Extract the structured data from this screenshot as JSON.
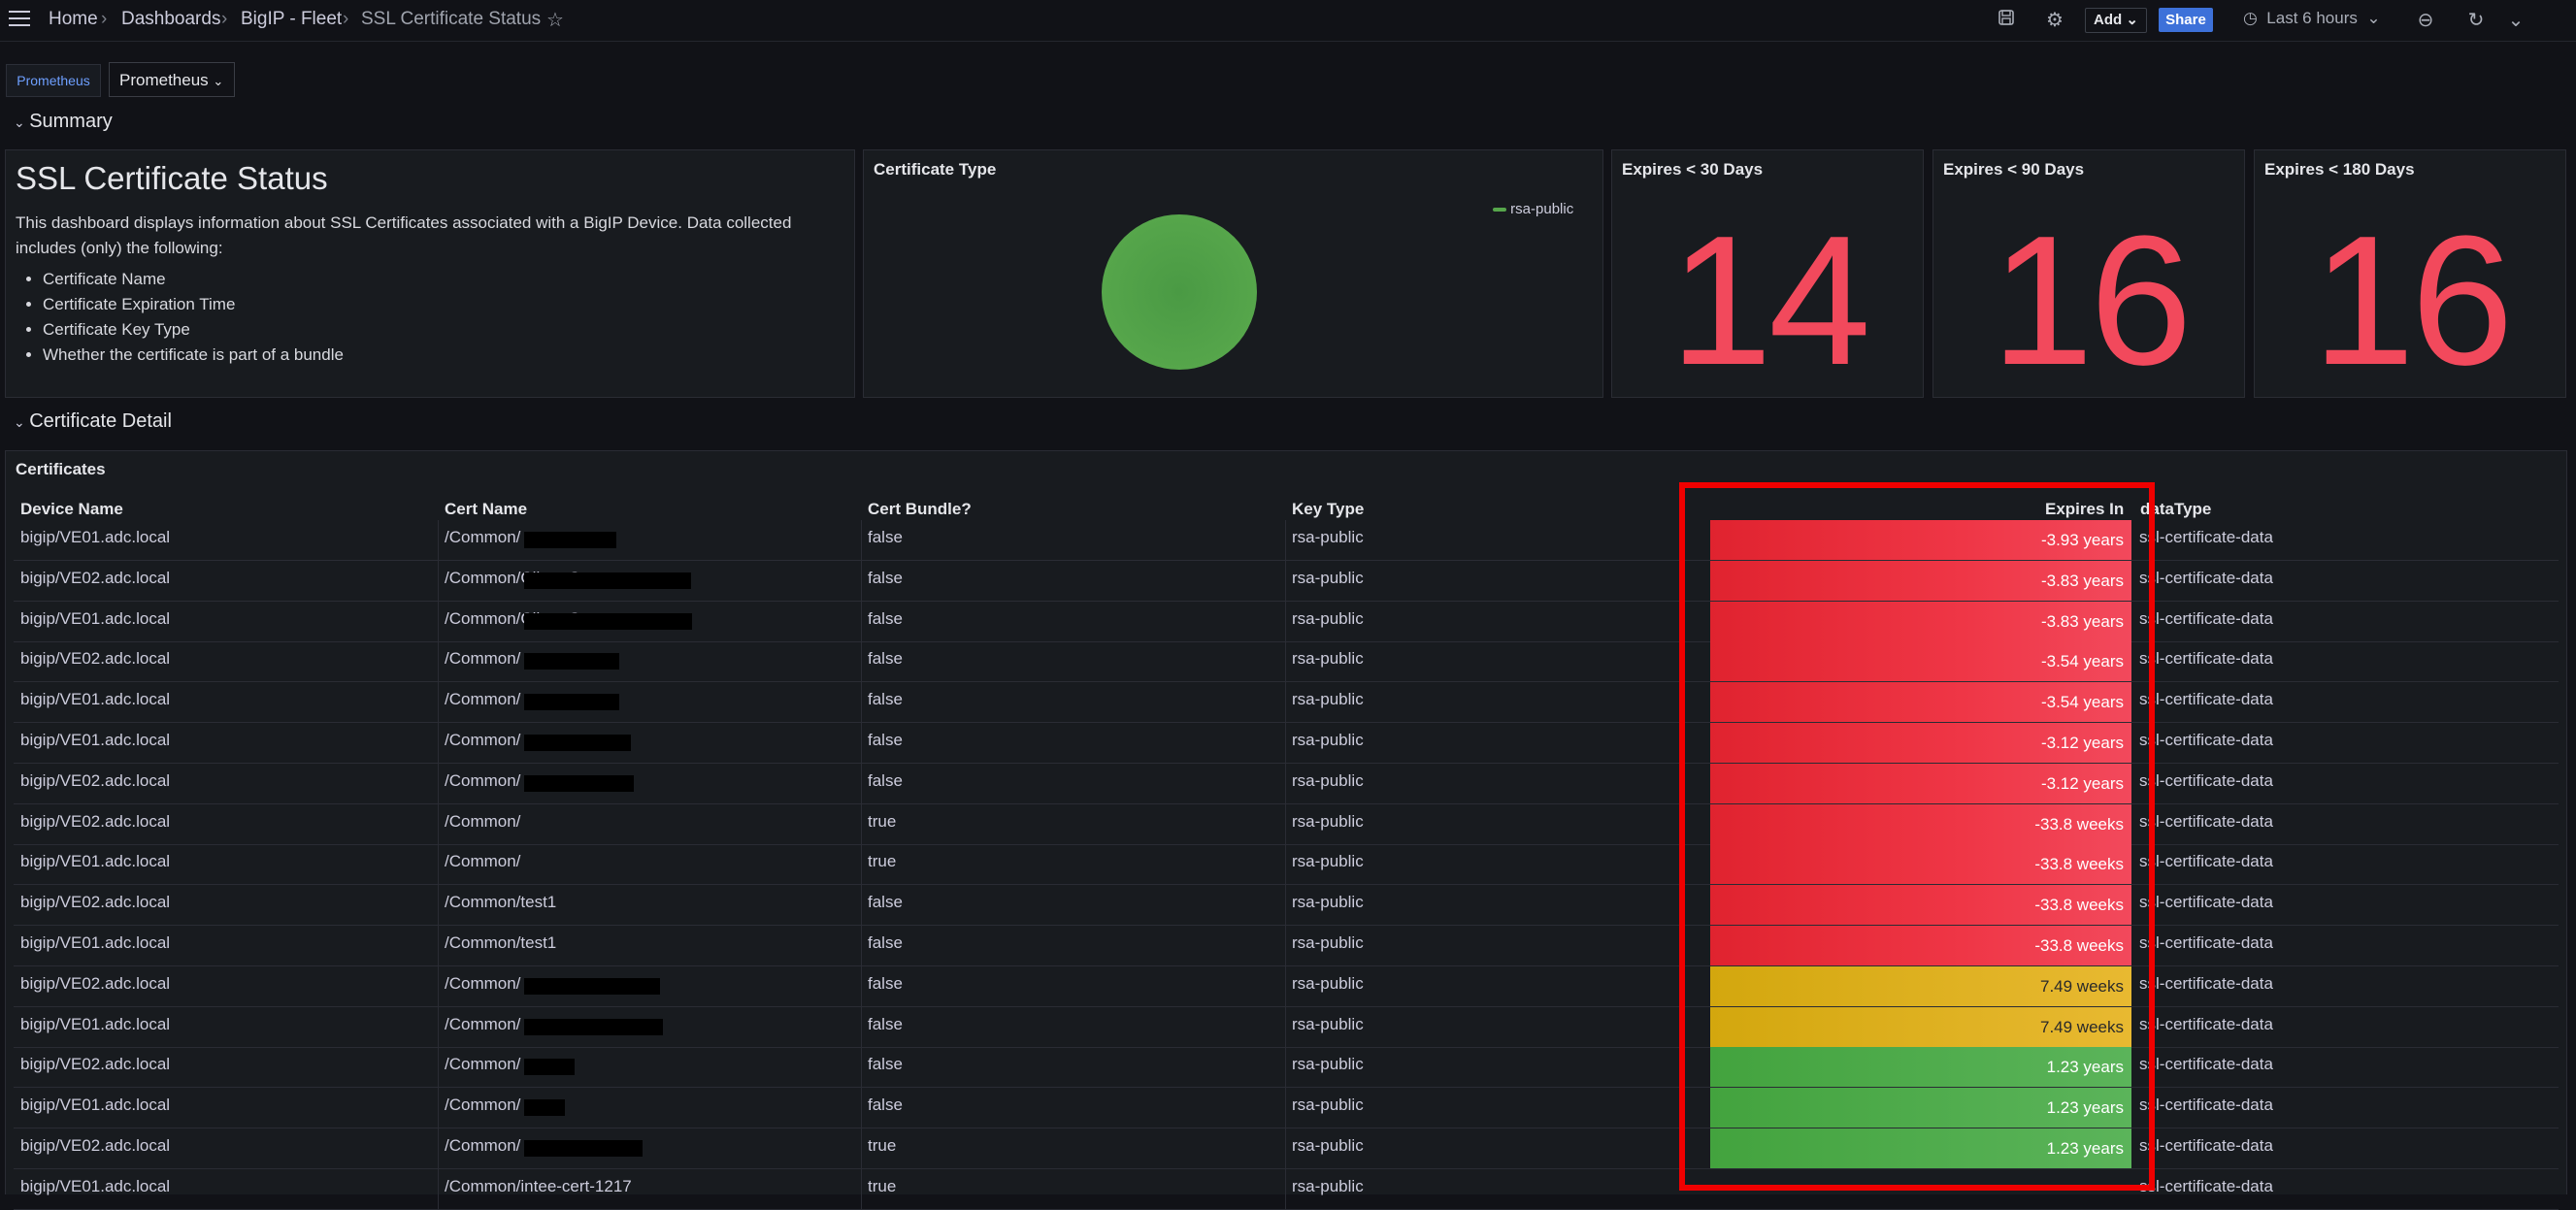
{
  "nav": {
    "breadcrumbs": [
      "Home",
      "Dashboards",
      "BigIP - Fleet",
      "SSL Certificate Status"
    ],
    "add_label": "Add",
    "share_label": "Share",
    "time_range": "Last 6 hours"
  },
  "variables": {
    "datasource_label": "Prometheus",
    "datasource_value": "Prometheus"
  },
  "rows": {
    "summary": "Summary",
    "detail": "Certificate Detail"
  },
  "text_panel": {
    "title": "SSL Certificate Status",
    "body": "This dashboard displays information about SSL Certificates associated with a BigIP Device. Data collected includes (only) the following:",
    "bullets": [
      "Certificate Name",
      "Certificate Expiration Time",
      "Certificate Key Type",
      "Whether the certificate is part of a bundle"
    ]
  },
  "pie_panel": {
    "title": "Certificate Type",
    "legend": "rsa-public",
    "color": "#56a64b"
  },
  "stats": [
    {
      "title": "Expires < 30 Days",
      "value": "14"
    },
    {
      "title": "Expires < 90 Days",
      "value": "16"
    },
    {
      "title": "Expires < 180 Days",
      "value": "16"
    }
  ],
  "table": {
    "title": "Certificates",
    "columns": [
      "Device Name",
      "Cert Name",
      "Cert Bundle?",
      "Key Type",
      "Expires In",
      "dataType"
    ],
    "rows": [
      {
        "device": "bigip/VE01.adc.local",
        "cert": "/Common/",
        "bundle": "false",
        "key": "rsa-public",
        "expires": "-3.93 years",
        "status": "red",
        "dtype": "ssl-certificate-data"
      },
      {
        "device": "bigip/VE02.adc.local",
        "cert": "/Common/Client-Cert",
        "bundle": "false",
        "key": "rsa-public",
        "expires": "-3.83 years",
        "status": "red",
        "dtype": "ssl-certificate-data"
      },
      {
        "device": "bigip/VE01.adc.local",
        "cert": "/Common/Client-Cert",
        "bundle": "false",
        "key": "rsa-public",
        "expires": "-3.83 years",
        "status": "red",
        "dtype": "ssl-certificate-data"
      },
      {
        "device": "bigip/VE02.adc.local",
        "cert": "/Common/",
        "bundle": "false",
        "key": "rsa-public",
        "expires": "-3.54 years",
        "status": "red",
        "dtype": "ssl-certificate-data"
      },
      {
        "device": "bigip/VE01.adc.local",
        "cert": "/Common/",
        "bundle": "false",
        "key": "rsa-public",
        "expires": "-3.54 years",
        "status": "red",
        "dtype": "ssl-certificate-data"
      },
      {
        "device": "bigip/VE01.adc.local",
        "cert": "/Common/",
        "bundle": "false",
        "key": "rsa-public",
        "expires": "-3.12 years",
        "status": "red",
        "dtype": "ssl-certificate-data"
      },
      {
        "device": "bigip/VE02.adc.local",
        "cert": "/Common/",
        "bundle": "false",
        "key": "rsa-public",
        "expires": "-3.12 years",
        "status": "red",
        "dtype": "ssl-certificate-data"
      },
      {
        "device": "bigip/VE02.adc.local",
        "cert": "/Common/",
        "bundle": "true",
        "key": "rsa-public",
        "expires": "-33.8 weeks",
        "status": "red",
        "dtype": "ssl-certificate-data"
      },
      {
        "device": "bigip/VE01.adc.local",
        "cert": "/Common/",
        "bundle": "true",
        "key": "rsa-public",
        "expires": "-33.8 weeks",
        "status": "red",
        "dtype": "ssl-certificate-data"
      },
      {
        "device": "bigip/VE02.adc.local",
        "cert": "/Common/test1",
        "bundle": "false",
        "key": "rsa-public",
        "expires": "-33.8 weeks",
        "status": "red",
        "dtype": "ssl-certificate-data"
      },
      {
        "device": "bigip/VE01.adc.local",
        "cert": "/Common/test1",
        "bundle": "false",
        "key": "rsa-public",
        "expires": "-33.8 weeks",
        "status": "red",
        "dtype": "ssl-certificate-data"
      },
      {
        "device": "bigip/VE02.adc.local",
        "cert": "/Common/",
        "bundle": "false",
        "key": "rsa-public",
        "expires": "7.49 weeks",
        "status": "yellow",
        "dtype": "ssl-certificate-data"
      },
      {
        "device": "bigip/VE01.adc.local",
        "cert": "/Common/",
        "bundle": "false",
        "key": "rsa-public",
        "expires": "7.49 weeks",
        "status": "yellow",
        "dtype": "ssl-certificate-data"
      },
      {
        "device": "bigip/VE02.adc.local",
        "cert": "/Common/",
        "bundle": "false",
        "key": "rsa-public",
        "expires": "1.23 years",
        "status": "green",
        "dtype": "ssl-certificate-data"
      },
      {
        "device": "bigip/VE01.adc.local",
        "cert": "/Common/",
        "bundle": "false",
        "key": "rsa-public",
        "expires": "1.23 years",
        "status": "green",
        "dtype": "ssl-certificate-data"
      },
      {
        "device": "bigip/VE02.adc.local",
        "cert": "/Common/",
        "bundle": "true",
        "key": "rsa-public",
        "expires": "1.23 years",
        "status": "green",
        "dtype": "ssl-certificate-data"
      },
      {
        "device": "bigip/VE01.adc.local",
        "cert": "/Common/intee-cert-1217",
        "bundle": "true",
        "key": "rsa-public",
        "expires": "",
        "status": "none",
        "dtype": "ssl-certificate-data"
      }
    ]
  }
}
